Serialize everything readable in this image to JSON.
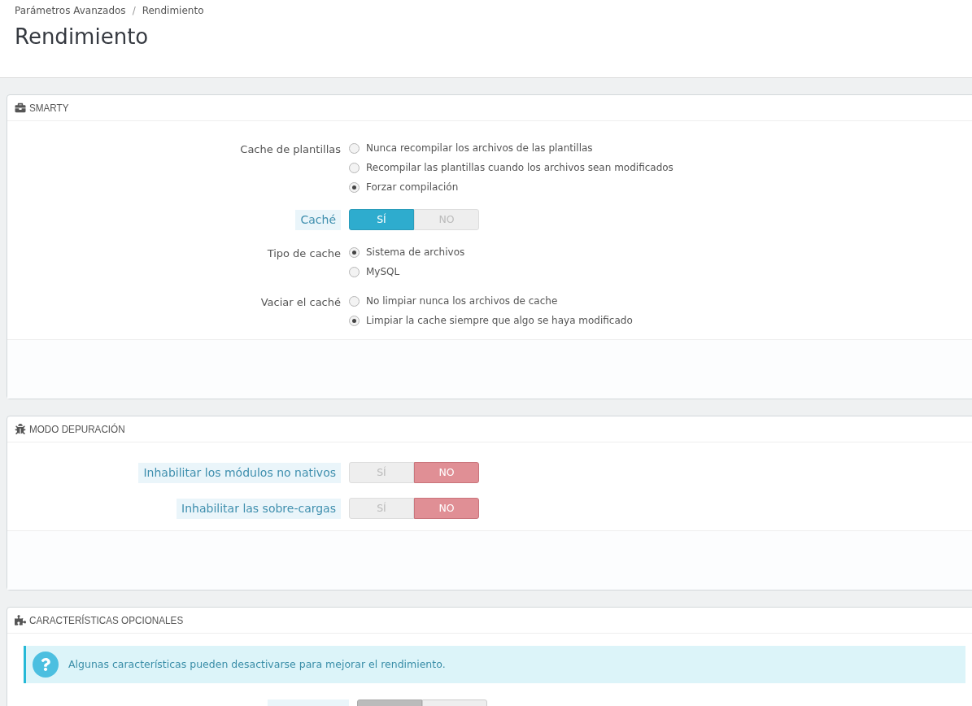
{
  "breadcrumb": [
    {
      "kind": "link",
      "label": "Parámetros Avanzados"
    },
    {
      "kind": "separator",
      "label": "/"
    },
    {
      "kind": "link",
      "label": "Rendimiento"
    }
  ],
  "page_title": "Rendimiento",
  "panels": [
    {
      "title": "SMARTY",
      "fields": [
        {
          "kind": "radio",
          "label": "Cache de plantillas",
          "hint": false,
          "options": [
            {
              "label": "Nunca recompilar los archivos de las plantillas",
              "selected": false
            },
            {
              "label": "Recompilar las plantillas cuando los archivos sean modificados",
              "selected": false
            },
            {
              "label": "Forzar compilación",
              "selected": true
            }
          ]
        },
        {
          "kind": "toggle",
          "label": "Caché",
          "hint": true,
          "options": [
            {
              "label": "SÍ",
              "selected": true
            },
            {
              "label": "NO",
              "selected": false
            }
          ]
        },
        {
          "kind": "radio",
          "label": "Tipo de cache",
          "hint": false,
          "options": [
            {
              "label": "Sistema de archivos",
              "selected": true
            },
            {
              "label": "MySQL",
              "selected": false
            }
          ]
        },
        {
          "kind": "radio",
          "label": "Vaciar el caché",
          "hint": false,
          "options": [
            {
              "label": "No limpiar nunca los archivos de cache",
              "selected": false
            },
            {
              "label": "Limpiar la cache siempre que algo se haya modificado",
              "selected": true
            }
          ]
        }
      ]
    },
    {
      "title": "MODO DEPURACIÓN",
      "fields": [
        {
          "kind": "toggle",
          "label": "Inhabilitar los módulos no nativos",
          "hint": true,
          "options": [
            {
              "label": "SÍ",
              "selected": false
            },
            {
              "label": "NO",
              "selected": true
            }
          ]
        },
        {
          "kind": "toggle",
          "label": "Inhabilitar las sobre-cargas",
          "hint": true,
          "options": [
            {
              "label": "SÍ",
              "selected": false
            },
            {
              "label": "NO",
              "selected": true
            }
          ]
        }
      ]
    },
    {
      "title": "CARACTERÍSTICAS OPCIONALES",
      "alert": "Algunas características pueden desactivarse para mejorar el rendimiento.",
      "cut_toggle": {
        "options": [
          {
            "selected": true
          },
          {
            "selected": false
          }
        ]
      }
    }
  ]
}
